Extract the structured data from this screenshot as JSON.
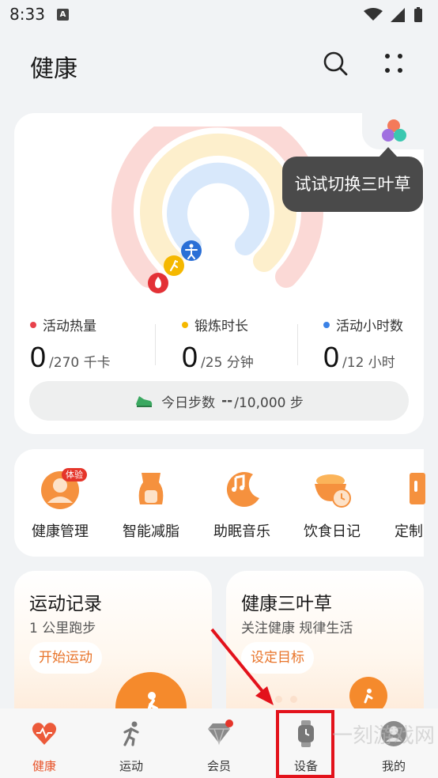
{
  "status_bar": {
    "time": "8:33",
    "notification_icon": "A"
  },
  "header": {
    "title": "健康",
    "icons": [
      "search-icon",
      "more-icon"
    ]
  },
  "activity": {
    "tooltip": "试试切换三叶草",
    "rings": {
      "calories_fraction": 0.0,
      "exercise_fraction": 0.0,
      "hours_fraction": 0.0
    },
    "colors": {
      "calories": "#e8414b",
      "exercise": "#f5b800",
      "hours": "#3b82e6"
    },
    "stats": [
      {
        "label": "活动热量",
        "value": "0",
        "goal": "/270 千卡"
      },
      {
        "label": "锻炼时长",
        "value": "0",
        "goal": "/25 分钟"
      },
      {
        "label": "活动小时数",
        "value": "0",
        "goal": "/12 小时"
      }
    ],
    "steps": {
      "label": "今日步数",
      "value": "--",
      "goal": "/10,000 步"
    }
  },
  "shortcuts": [
    {
      "label": "健康管理",
      "badge": "体验",
      "icon": "health-management-icon"
    },
    {
      "label": "智能减脂",
      "icon": "fat-loss-icon"
    },
    {
      "label": "助眠音乐",
      "icon": "sleep-music-icon"
    },
    {
      "label": "饮食日记",
      "icon": "diet-diary-icon"
    },
    {
      "label": "定制",
      "icon": "custom-plan-icon"
    }
  ],
  "cards": [
    {
      "title": "运动记录",
      "subtitle": "1 公里跑步",
      "button": "开始运动"
    },
    {
      "title": "健康三叶草",
      "subtitle": "关注健康 规律生活",
      "button": "设定目标"
    }
  ],
  "nav": [
    {
      "label": "健康",
      "icon": "heart-icon",
      "active": true
    },
    {
      "label": "运动",
      "icon": "running-icon"
    },
    {
      "label": "会员",
      "icon": "vip-diamond-icon"
    },
    {
      "label": "设备",
      "icon": "watch-icon"
    },
    {
      "label": "我的",
      "icon": "profile-icon"
    }
  ],
  "watermark": "一刻游戏网"
}
